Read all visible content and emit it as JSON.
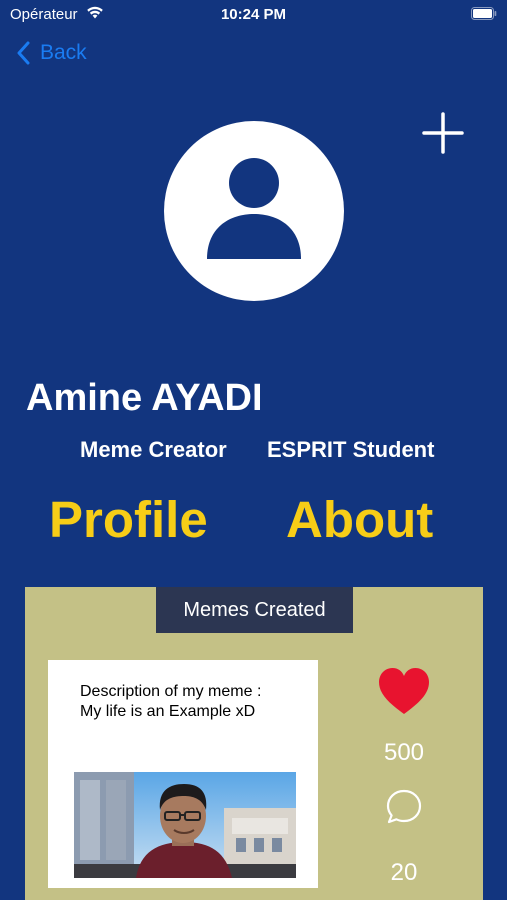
{
  "status_bar": {
    "carrier": "Opérateur",
    "time": "10:24 PM"
  },
  "nav": {
    "back_label": "Back"
  },
  "profile": {
    "name": "Amine AYADI",
    "roles": [
      "Meme Creator",
      "ESPRIT Student"
    ]
  },
  "tabs": [
    "Profile",
    "About"
  ],
  "memes_section": {
    "title": "Memes Created",
    "meme": {
      "description_lines": [
        "Description of my meme :",
        "My life is an Example xD"
      ],
      "likes": "500",
      "comments": "20"
    }
  },
  "icons": [
    "wifi-icon",
    "battery-icon",
    "chevron-left-icon",
    "plus-icon",
    "user-icon",
    "heart-icon",
    "comment-icon"
  ],
  "colors": {
    "background": "#12357f",
    "accent_yellow": "#f7cd17",
    "link_blue": "#1a7cf2",
    "card_background": "#c4c186",
    "section_header": "#2c3652",
    "heart_red": "#e8132f"
  }
}
